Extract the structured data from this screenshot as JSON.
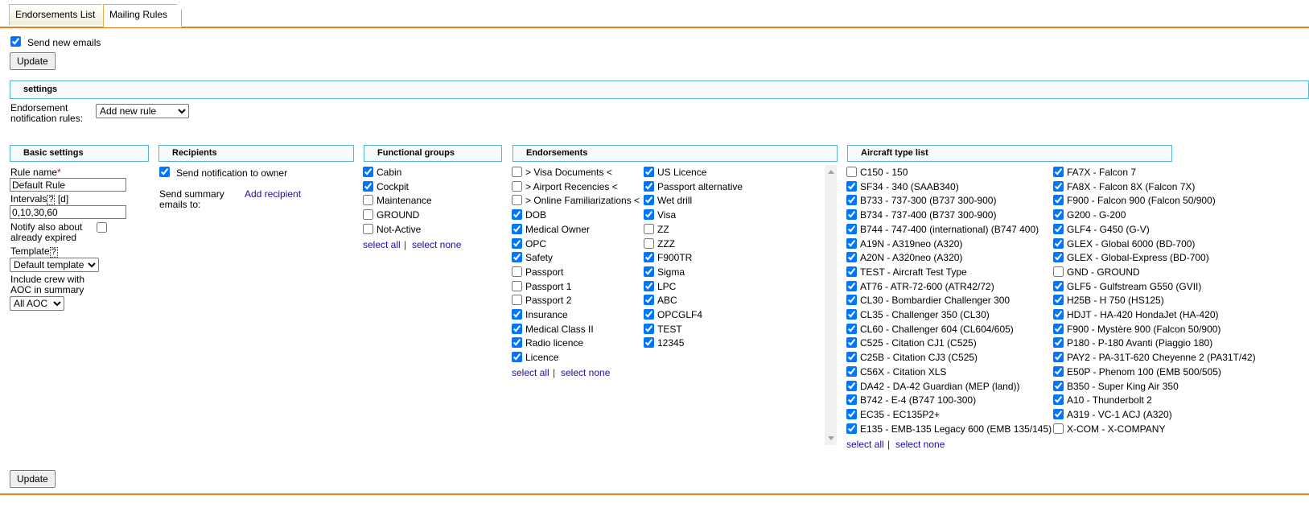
{
  "tabs": [
    "Endorsements List",
    "Mailing Rules"
  ],
  "send_new_emails": {
    "label": "Send new emails",
    "checked": true
  },
  "update_label": "Update",
  "settings_title": "settings",
  "notif_rules": {
    "label": "Endorsement notification rules:",
    "value": "Add new rule",
    "options": [
      "Add new rule"
    ]
  },
  "sections": {
    "basic": "Basic settings",
    "recipients": "Recipients",
    "functional": "Functional groups",
    "endorsements": "Endorsements",
    "aircraft": "Aircraft type list"
  },
  "basic": {
    "rule_name_label": "Rule name",
    "rule_name_required": "*",
    "rule_name_value": "Default Rule",
    "intervals_label": "Intervals",
    "intervals_help": "?",
    "intervals_unit": "[d]",
    "intervals_value": "0,10,30,60",
    "notify_label": "Notify also about already expired",
    "notify_checked": false,
    "template_label": "Template",
    "template_help": "?",
    "template_value": "Default template",
    "include_crew_label": "Include crew with AOC in summary",
    "aoc_value": "All AOC"
  },
  "recipients": {
    "notify_owner": {
      "label": "Send notification to owner",
      "checked": true
    },
    "summary_label": "Send summary emails to:",
    "add_recipient": "Add recipient"
  },
  "select_all": "select all",
  "select_none": "select none",
  "separator": "|",
  "functional_groups": [
    {
      "label": "Cabin",
      "checked": true
    },
    {
      "label": "Cockpit",
      "checked": true
    },
    {
      "label": "Maintenance",
      "checked": false
    },
    {
      "label": "GROUND",
      "checked": false
    },
    {
      "label": "Not-Active",
      "checked": false
    }
  ],
  "endorsements_col1": [
    {
      "label": "> Visa Documents <",
      "checked": false
    },
    {
      "label": "> Airport Recencies <",
      "checked": false
    },
    {
      "label": "> Online Familiarizations <",
      "checked": false
    },
    {
      "label": "DOB",
      "checked": true
    },
    {
      "label": "Medical Owner",
      "checked": true
    },
    {
      "label": "OPC",
      "checked": true
    },
    {
      "label": "Safety",
      "checked": true
    },
    {
      "label": "Passport",
      "checked": false
    },
    {
      "label": "Passport 1",
      "checked": false
    },
    {
      "label": "Passport 2",
      "checked": false
    },
    {
      "label": "Insurance",
      "checked": true
    },
    {
      "label": "Medical Class II",
      "checked": true
    },
    {
      "label": "Radio licence",
      "checked": true
    },
    {
      "label": "Licence",
      "checked": true
    }
  ],
  "endorsements_col2": [
    {
      "label": "US Licence",
      "checked": true
    },
    {
      "label": "Passport alternative",
      "checked": true
    },
    {
      "label": "Wet drill",
      "checked": true
    },
    {
      "label": "Visa",
      "checked": true
    },
    {
      "label": "ZZ",
      "checked": false
    },
    {
      "label": "ZZZ",
      "checked": false
    },
    {
      "label": "F900TR",
      "checked": true
    },
    {
      "label": "Sigma",
      "checked": true
    },
    {
      "label": "LPC",
      "checked": true
    },
    {
      "label": "ABC",
      "checked": true
    },
    {
      "label": "OPCGLF4",
      "checked": true
    },
    {
      "label": "TEST",
      "checked": true
    },
    {
      "label": "12345",
      "checked": true
    }
  ],
  "aircraft_col1": [
    {
      "label": "C150 - 150",
      "checked": false
    },
    {
      "label": "SF34 - 340 (SAAB340)",
      "checked": true
    },
    {
      "label": "B733 - 737-300 (B737 300-900)",
      "checked": true
    },
    {
      "label": "B734 - 737-400 (B737 300-900)",
      "checked": true
    },
    {
      "label": "B744 - 747-400 (international) (B747 400)",
      "checked": true
    },
    {
      "label": "A19N - A319neo (A320)",
      "checked": true
    },
    {
      "label": "A20N - A320neo (A320)",
      "checked": true
    },
    {
      "label": "TEST - Aircraft Test Type",
      "checked": true
    },
    {
      "label": "AT76 - ATR-72-600 (ATR42/72)",
      "checked": true
    },
    {
      "label": "CL30 - Bombardier Challenger 300",
      "checked": true
    },
    {
      "label": "CL35 - Challenger 350 (CL30)",
      "checked": true
    },
    {
      "label": "CL60 - Challenger 604 (CL604/605)",
      "checked": true
    },
    {
      "label": "C525 - Citation CJ1 (C525)",
      "checked": true
    },
    {
      "label": "C25B - Citation CJ3 (C525)",
      "checked": true
    },
    {
      "label": "C56X - Citation XLS",
      "checked": true
    },
    {
      "label": "DA42 - DA-42 Guardian (MEP (land))",
      "checked": true
    },
    {
      "label": "B742 - E-4 (B747 100-300)",
      "checked": true
    },
    {
      "label": "EC35 - EC135P2+",
      "checked": true
    },
    {
      "label": "E135 - EMB-135 Legacy 600 (EMB 135/145)",
      "checked": true
    }
  ],
  "aircraft_col2": [
    {
      "label": "FA7X - Falcon 7",
      "checked": true
    },
    {
      "label": "FA8X - Falcon 8X (Falcon 7X)",
      "checked": true
    },
    {
      "label": "F900 - Falcon 900 (Falcon 50/900)",
      "checked": true
    },
    {
      "label": "G200 - G-200",
      "checked": true
    },
    {
      "label": "GLF4 - G450 (G-V)",
      "checked": true
    },
    {
      "label": "GLEX - Global 6000 (BD-700)",
      "checked": true
    },
    {
      "label": "GLEX - Global-Express (BD-700)",
      "checked": true
    },
    {
      "label": "GND - GROUND",
      "checked": false
    },
    {
      "label": "GLF5 - Gulfstream G550 (GVII)",
      "checked": true
    },
    {
      "label": "H25B - H 750 (HS125)",
      "checked": true
    },
    {
      "label": "HDJT - HA-420 HondaJet (HA-420)",
      "checked": true
    },
    {
      "label": "F900 - Mystère 900 (Falcon 50/900)",
      "checked": true
    },
    {
      "label": "P180 - P-180 Avanti (Piaggio 180)",
      "checked": true
    },
    {
      "label": "PAY2 - PA-31T-620 Cheyenne 2 (PA31T/42)",
      "checked": true
    },
    {
      "label": "E50P - Phenom 100 (EMB 500/505)",
      "checked": true
    },
    {
      "label": "B350 - Super King Air 350",
      "checked": true
    },
    {
      "label": "A10 - Thunderbolt 2",
      "checked": true
    },
    {
      "label": "A319 - VC-1 ACJ (A320)",
      "checked": true
    },
    {
      "label": "X-COM - X-COMPANY",
      "checked": false
    }
  ]
}
